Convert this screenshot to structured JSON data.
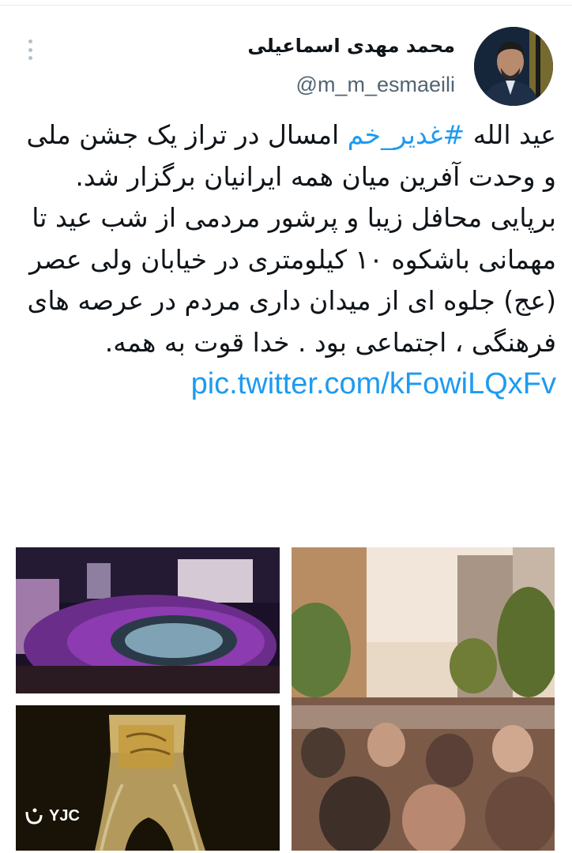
{
  "tweet": {
    "display_name": "محمد مهدی اسماعیلی",
    "handle": "@m_m_esmaeili",
    "text_prefix": "عید الله ",
    "hashtag": "#غدیر_خم",
    "text_body": " امسال در تراز یک جشن ملی و وحدت آفرین میان همه ایرانیان برگزار شد. برپایی محافل زیبا و پرشور مردمی از شب عید تا مهمانی باشکوه ۱۰ کیلومتری در خیابان ولی عصر (عج) جلوه ای از میدان داری مردم در عرصه های فرهنگی ، اجتماعی بود . خدا قوت به همه. ",
    "link": "pic.twitter.com/kFowiLQxFv"
  },
  "watermark": {
    "text": "YJC"
  },
  "icons": {
    "more": "more-vertical-icon",
    "watermark_logo": "yjc-logo-icon"
  },
  "colors": {
    "link": "#1d9bf0",
    "text": "#0f1419",
    "muted": "#536471"
  }
}
